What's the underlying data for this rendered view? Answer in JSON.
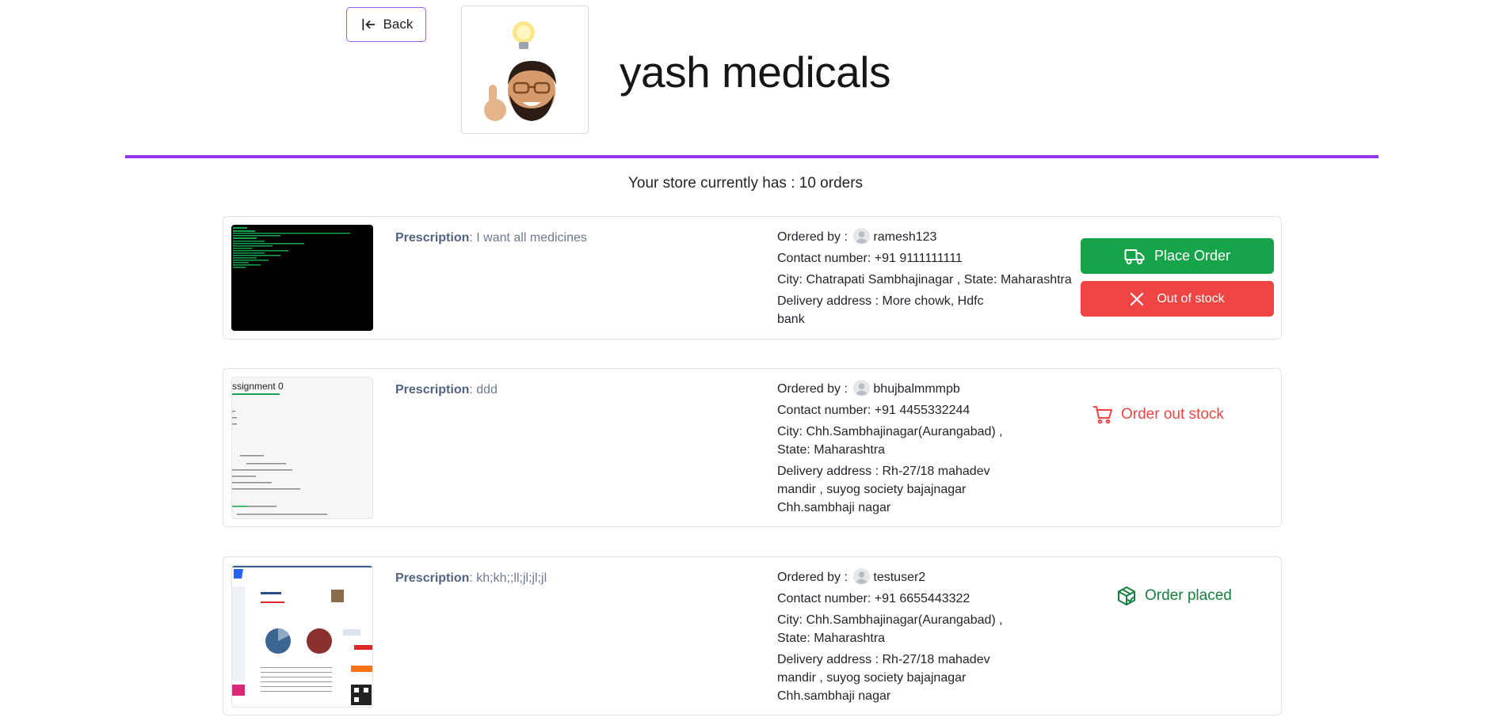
{
  "header": {
    "back_label": "Back",
    "store_name": "yash medicals",
    "order_count_text": "Your store currently has : 10 orders"
  },
  "labels": {
    "prescription": "Prescription",
    "ordered_by": "Ordered by :",
    "contact_prefix": "Contact number: ",
    "city_prefix": "City: ",
    "state_prefix": ", State: ",
    "address_prefix": "Delivery address : "
  },
  "orders": [
    {
      "prescription": ": I want all medicines",
      "user": "ramesh123",
      "contact": "+91 9111111111",
      "city": "Chatrapati Sambhajinagar ",
      "state": "Maharashtra",
      "address": "More chowk, Hdfc bank",
      "place_order_label": "Place Order",
      "out_of_stock_label": "Out of stock"
    },
    {
      "prescription": ": ddd",
      "user": "bhujbalmmmpb",
      "contact": "+91 4455332244",
      "city": "Chh.Sambhajinagar(Aurangabad) ",
      "state": "Maharashtra",
      "address": "Rh-27/18 mahadev mandir , suyog society bajajnagar Chh.sambhaji nagar",
      "status_label": "Order out stock"
    },
    {
      "prescription": ": kh;kh;;ll;jl;jl;jl",
      "user": "testuser2",
      "contact": "+91 6655443322",
      "city": "Chh.Sambhajinagar(Aurangabad) ",
      "state": "Maharashtra",
      "address": "Rh-27/18 mahadev mandir , suyog society bajajnagar Chh.sambhaji nagar",
      "status_label": "Order placed"
    }
  ],
  "thumbnail_texts": {
    "assignment": "ssignment 0"
  },
  "colors": {
    "accent_purple": "#9333ea",
    "success_green": "#16a34a",
    "danger_red": "#ef4444"
  }
}
